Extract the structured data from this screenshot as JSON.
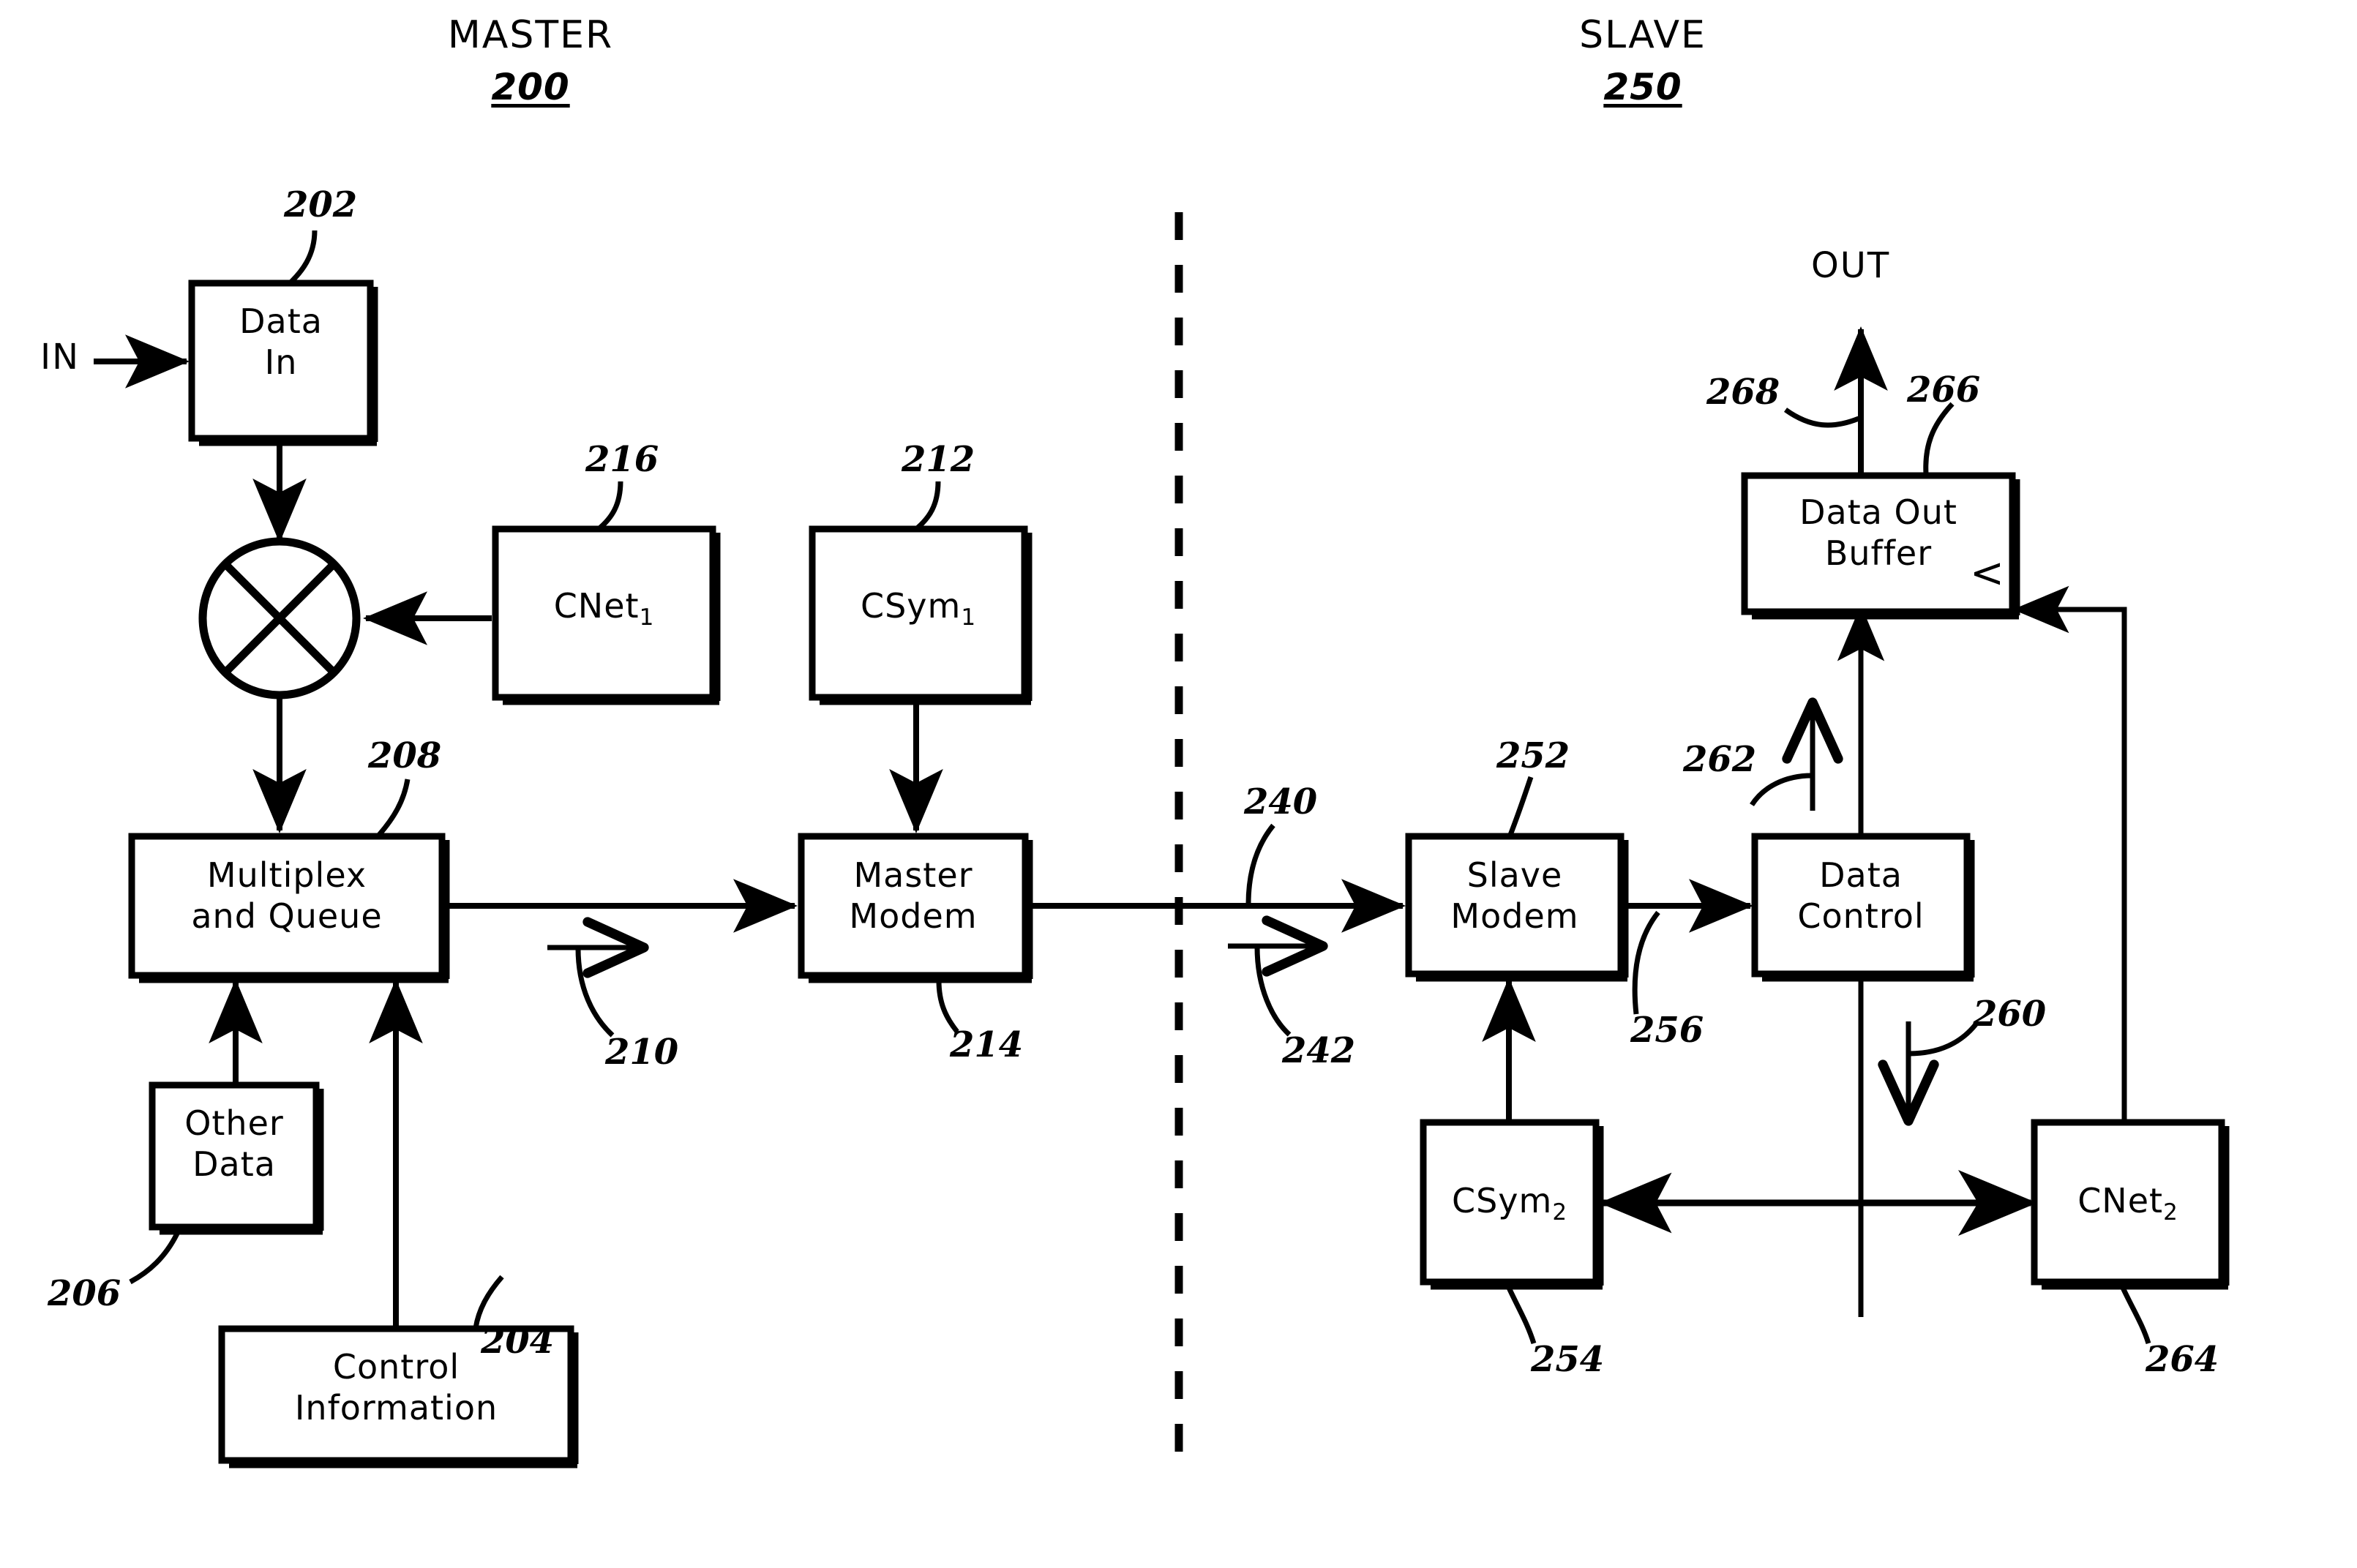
{
  "figure": {
    "type": "patent-block-diagram",
    "sections": [
      {
        "title": "MASTER",
        "number": "200"
      },
      {
        "title": "SLAVE",
        "number": "250"
      }
    ],
    "ports": [
      {
        "name": "IN",
        "label": "IN"
      },
      {
        "name": "OUT",
        "label": "OUT"
      }
    ],
    "blocks": [
      {
        "id": "data_in",
        "label": "Data\nIn",
        "ref": "202"
      },
      {
        "id": "control_information",
        "label": "Control\nInformation",
        "ref": "204"
      },
      {
        "id": "other_data",
        "label": "Other\nData",
        "ref": "206"
      },
      {
        "id": "multiplex_queue",
        "label": "Multiplex\nand  Queue",
        "ref": "208"
      },
      {
        "id": "csym1",
        "label": "CSym",
        "sub": "1",
        "ref": "212"
      },
      {
        "id": "master_modem",
        "label": "Master\nModem",
        "ref": "214"
      },
      {
        "id": "cnet1",
        "label": "CNet",
        "sub": "1",
        "ref": "216"
      },
      {
        "id": "slave_modem",
        "label": "Slave\nModem",
        "ref": "252"
      },
      {
        "id": "csym2",
        "label": "CSym",
        "sub": "2",
        "ref": "254"
      },
      {
        "id": "data_control",
        "label": "Data\nControl",
        "ref": "256"
      },
      {
        "id": "cnet2",
        "label": "CNet",
        "sub": "2",
        "ref": "264"
      },
      {
        "id": "data_out_buffer",
        "label": "Data  Out\nBuffer",
        "ref": "266",
        "marker": "<"
      }
    ],
    "mixer": {
      "id": "mixer",
      "symbol": "circle-with-x"
    },
    "signal_refs": [
      {
        "id": "s210",
        "ref": "210"
      },
      {
        "id": "s240",
        "ref": "240"
      },
      {
        "id": "s242",
        "ref": "242"
      },
      {
        "id": "s260",
        "ref": "260"
      },
      {
        "id": "s262",
        "ref": "262"
      },
      {
        "id": "s268",
        "ref": "268"
      }
    ],
    "divider": {
      "id": "master-slave-divider",
      "style": "dashed-vertical"
    },
    "colors": {
      "ink": "#000000",
      "paper": "#ffffff"
    }
  }
}
